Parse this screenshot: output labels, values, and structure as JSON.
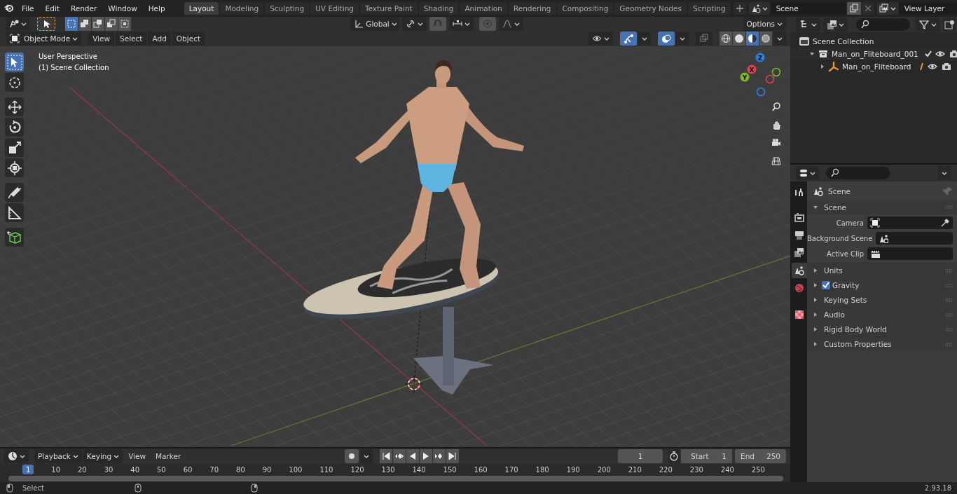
{
  "app_menu": {
    "menus": [
      "File",
      "Edit",
      "Render",
      "Window",
      "Help"
    ]
  },
  "workspace_tabs": [
    {
      "label": "Layout",
      "selected": true
    },
    {
      "label": "Modeling",
      "selected": false
    },
    {
      "label": "Sculpting",
      "selected": false
    },
    {
      "label": "UV Editing",
      "selected": false
    },
    {
      "label": "Texture Paint",
      "selected": false
    },
    {
      "label": "Shading",
      "selected": false
    },
    {
      "label": "Animation",
      "selected": false
    },
    {
      "label": "Rendering",
      "selected": false
    },
    {
      "label": "Compositing",
      "selected": false
    },
    {
      "label": "Geometry Nodes",
      "selected": false
    },
    {
      "label": "Scripting",
      "selected": false
    }
  ],
  "scene_selector": {
    "value": "Scene"
  },
  "view_layer_selector": {
    "value": "View Layer"
  },
  "tool_settings": {
    "select_modes": [
      {
        "kind": "set",
        "selected": true
      },
      {
        "kind": "extend",
        "selected": false
      },
      {
        "kind": "subtract",
        "selected": false
      },
      {
        "kind": "difference",
        "selected": false
      },
      {
        "kind": "intersect",
        "selected": false
      }
    ],
    "orientation": "Global",
    "options": "Options"
  },
  "viewport_header": {
    "mode": "Object Mode",
    "menus": [
      "View",
      "Select",
      "Add",
      "Object"
    ],
    "toggles": [
      {
        "kind": "gizmos",
        "on": true
      },
      {
        "kind": "overlays",
        "on": true
      },
      {
        "kind": "xray",
        "on": false
      }
    ],
    "shading": [
      {
        "kind": "wireframe",
        "selected": false
      },
      {
        "kind": "solid",
        "selected": false
      },
      {
        "kind": "material",
        "selected": true
      },
      {
        "kind": "rendered",
        "selected": false
      }
    ]
  },
  "viewport": {
    "tools": [
      {
        "kind": "select_box",
        "selected": true
      },
      {
        "kind": "cursor",
        "selected": false
      },
      {
        "kind": "move",
        "selected": false
      },
      {
        "kind": "rotate",
        "selected": false
      },
      {
        "kind": "scale",
        "selected": false
      },
      {
        "kind": "transform",
        "selected": false
      },
      {
        "kind": "annotate",
        "selected": false
      },
      {
        "kind": "measure",
        "selected": false
      },
      {
        "kind": "add_cube",
        "selected": false
      }
    ],
    "overlay_text": [
      "User Perspective",
      "(1) Scene Collection"
    ],
    "gizmo": [
      {
        "kind": "z",
        "label": "Z"
      },
      {
        "kind": "x",
        "label": "X"
      },
      {
        "kind": "y",
        "label": "Y"
      }
    ]
  },
  "outliner": {
    "items": [
      {
        "label": "Scene Collection",
        "kind": "scene_collection",
        "children": [
          {
            "label": "Man_on_Fliteboard_001",
            "kind": "collection",
            "expanded": true,
            "checked": true,
            "children": [
              {
                "label": "Man_on_Fliteboard",
                "kind": "armature",
                "expanded": false
              }
            ]
          }
        ]
      }
    ]
  },
  "properties": {
    "tabs": [
      {
        "kind": "tool",
        "selected": false
      },
      {
        "kind": "render",
        "selected": false
      },
      {
        "kind": "output",
        "selected": false
      },
      {
        "kind": "view_layer",
        "selected": false
      },
      {
        "kind": "scene",
        "selected": true
      },
      {
        "kind": "world",
        "selected": false
      },
      {
        "kind": "texture",
        "selected": false
      }
    ],
    "context": "Scene",
    "panels": [
      {
        "title": "Scene",
        "kind": "plain",
        "expanded": true,
        "fields": [
          {
            "label": "Camera",
            "kind": "camera"
          },
          {
            "label": "Background Scene",
            "kind": "scene"
          },
          {
            "label": "Active Clip",
            "kind": "clip"
          }
        ]
      },
      {
        "title": "Units",
        "kind": "plain",
        "expanded": false
      },
      {
        "title": "Gravity",
        "kind": "checkbox",
        "checked": true,
        "expanded": false
      },
      {
        "title": "Keying Sets",
        "kind": "plain",
        "expanded": false
      },
      {
        "title": "Audio",
        "kind": "plain",
        "expanded": false
      },
      {
        "title": "Rigid Body World",
        "kind": "plain",
        "expanded": false
      },
      {
        "title": "Custom Properties",
        "kind": "plain",
        "expanded": false
      }
    ]
  },
  "timeline": {
    "menus": [
      {
        "label": "Playback",
        "kind": "dropdown"
      },
      {
        "label": "Keying",
        "kind": "dropdown"
      },
      {
        "label": "View",
        "kind": "menu"
      },
      {
        "label": "Marker",
        "kind": "menu"
      }
    ],
    "auto_keying": {
      "on": false
    },
    "transport": [
      {
        "kind": "jump_start"
      },
      {
        "kind": "prev_key"
      },
      {
        "kind": "play_reverse"
      },
      {
        "kind": "play"
      },
      {
        "kind": "next_key"
      },
      {
        "kind": "jump_end"
      }
    ],
    "current_frame": "1",
    "start_label": "Start",
    "start": "1",
    "end_label": "End",
    "end": "250",
    "playhead": "1",
    "ruler": [
      "10",
      "20",
      "30",
      "40",
      "50",
      "60",
      "70",
      "80",
      "90",
      "100",
      "110",
      "120",
      "130",
      "140",
      "150",
      "160",
      "170",
      "180",
      "190",
      "200",
      "210",
      "220",
      "230",
      "240",
      "250"
    ]
  },
  "status_bar": {
    "action": "Select",
    "version": "2.93.18"
  }
}
